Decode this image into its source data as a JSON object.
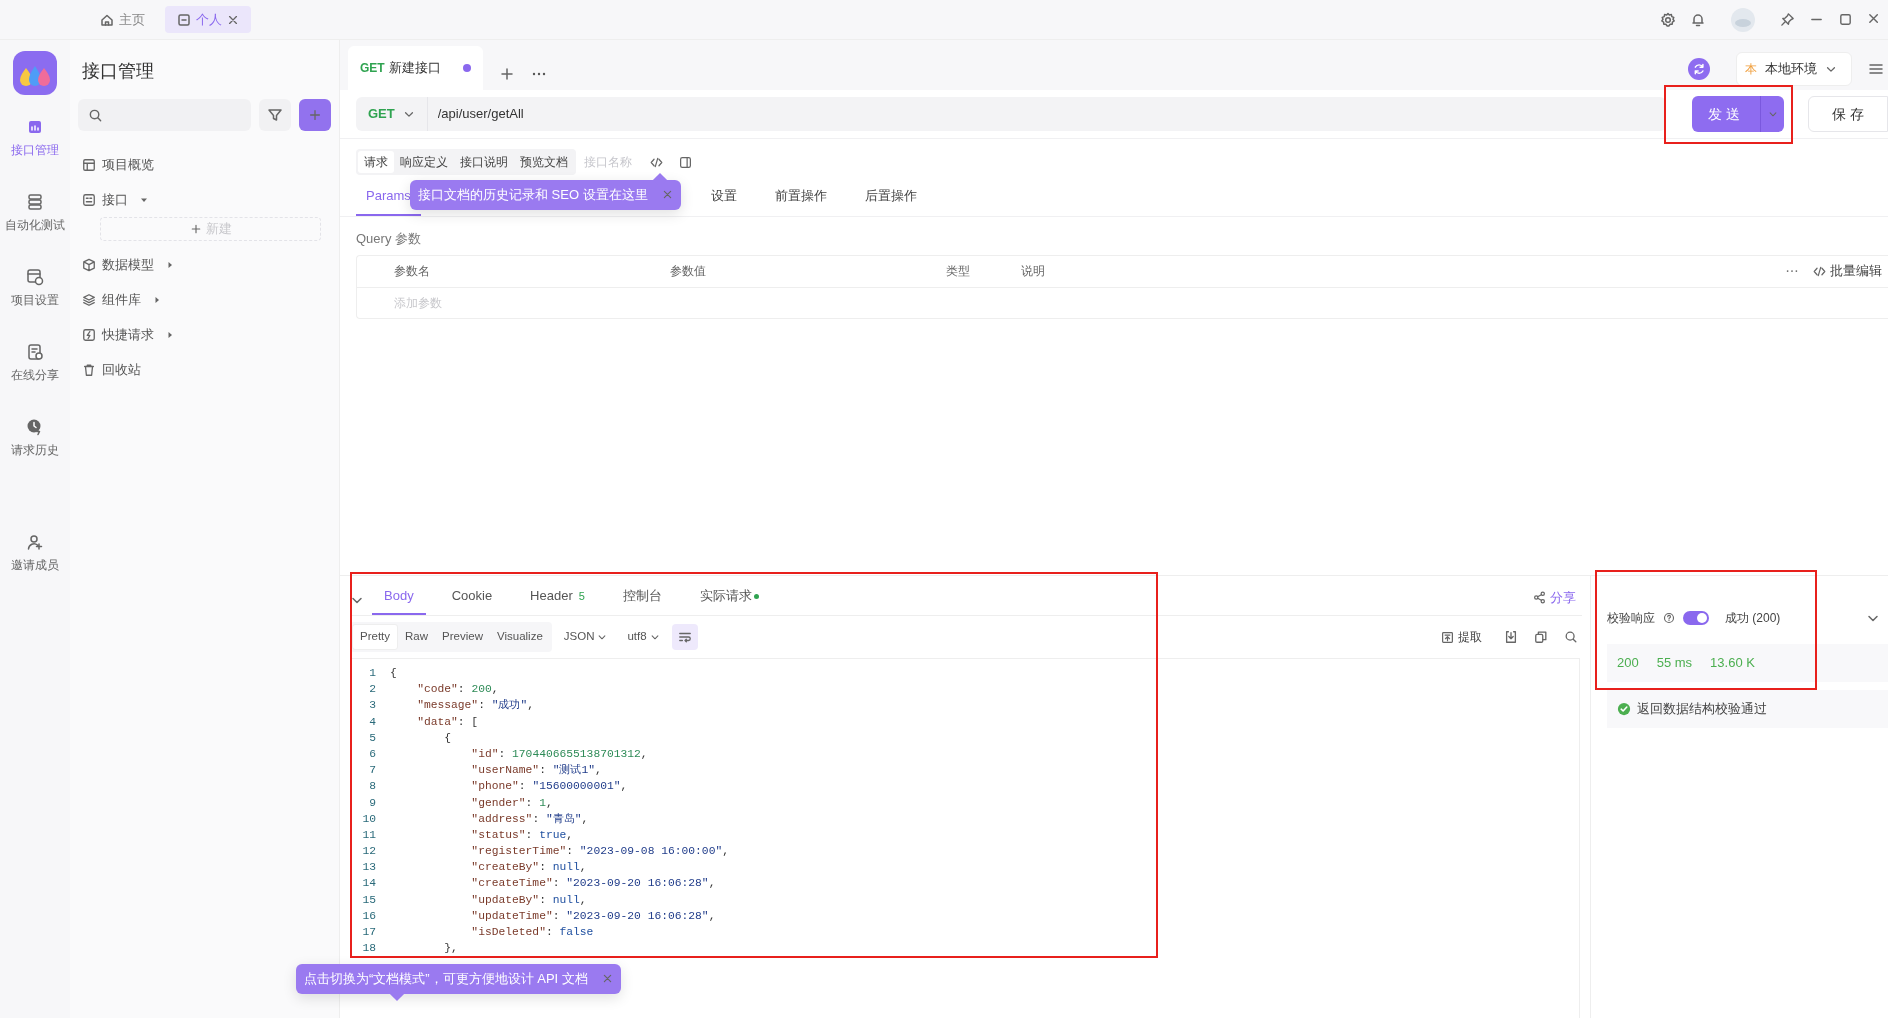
{
  "title_bar": {
    "tabs": [
      {
        "label": "主页",
        "selected": false,
        "closable": false
      },
      {
        "label": "个人",
        "selected": true,
        "closable": true
      }
    ]
  },
  "rail": {
    "items": [
      {
        "label": "接口管理",
        "selected": true
      },
      {
        "label": "自动化测试",
        "selected": false
      },
      {
        "label": "项目设置",
        "selected": false
      },
      {
        "label": "在线分享",
        "selected": false
      },
      {
        "label": "请求历史",
        "selected": false
      },
      {
        "label": "邀请成员",
        "selected": false
      }
    ]
  },
  "sidebar": {
    "title": "接口管理",
    "items": [
      {
        "label": "项目概览",
        "kind": "page"
      },
      {
        "label": "接口",
        "kind": "folder",
        "expanded": true,
        "new_label": "新建"
      },
      {
        "label": "数据模型",
        "kind": "folder",
        "expanded": false
      },
      {
        "label": "组件库",
        "kind": "folder",
        "expanded": false
      },
      {
        "label": "快捷请求",
        "kind": "folder",
        "expanded": false
      },
      {
        "label": "回收站",
        "kind": "page"
      }
    ]
  },
  "request_tabs": [
    {
      "method": "GET",
      "title": "新建接口",
      "modified": true,
      "selected": true
    }
  ],
  "environment": {
    "badge": "本",
    "name": "本地环境"
  },
  "url_bar": {
    "method": "GET",
    "url": "/api/user/getAll"
  },
  "send_button": {
    "label": "发送",
    "highlighted": true
  },
  "save_button": {
    "label": "保 存"
  },
  "doc_tabs": [
    {
      "label": "请求",
      "selected": true
    },
    {
      "label": "响应定义",
      "selected": false
    },
    {
      "label": "接口说明",
      "selected": false
    },
    {
      "label": "预览文档",
      "selected": false
    }
  ],
  "name_placeholder": "接口名称",
  "param_tabs": [
    {
      "label": "Params",
      "selected": true
    },
    {
      "label": "设置",
      "selected": false
    },
    {
      "label": "前置操作",
      "selected": false
    },
    {
      "label": "后置操作",
      "selected": false
    }
  ],
  "tooltips": [
    {
      "text": "接口文档的历史记录和 SEO 设置在这里"
    },
    {
      "text": "点击切换为“文档模式”，可更方便地设计 API 文档"
    }
  ],
  "query": {
    "label": "Query 参数",
    "columns": [
      "参数名",
      "参数值",
      "类型",
      "说明"
    ],
    "bulk_edit": "批量编辑",
    "add_placeholder": "添加参数"
  },
  "response": {
    "highlighted": true,
    "share": "分享",
    "extract": "提取",
    "type_select": "JSON",
    "encoding_select": "utf8",
    "wrap": true,
    "tabs": [
      {
        "label": "Body",
        "selected": true
      },
      {
        "label": "Cookie",
        "selected": false
      },
      {
        "label": "Header",
        "count": "5",
        "selected": false
      },
      {
        "label": "控制台",
        "selected": false
      },
      {
        "label": "实际请求",
        "dot": true,
        "selected": false
      }
    ],
    "formats": [
      {
        "label": "Pretty",
        "selected": true
      },
      {
        "label": "Raw",
        "selected": false
      },
      {
        "label": "Preview",
        "selected": false
      },
      {
        "label": "Visualize",
        "selected": false
      }
    ],
    "lines": [
      {
        "number": "1",
        "code": "{"
      },
      {
        "number": "2",
        "code": "    \"code\": 200,"
      },
      {
        "number": "3",
        "code": "    \"message\": \"成功\","
      },
      {
        "number": "4",
        "code": "    \"data\": ["
      },
      {
        "number": "5",
        "code": "        {"
      },
      {
        "number": "6",
        "code": "            \"id\": 1704406655138701312,"
      },
      {
        "number": "7",
        "code": "            \"userName\": \"测试1\","
      },
      {
        "number": "8",
        "code": "            \"phone\": \"15600000001\","
      },
      {
        "number": "9",
        "code": "            \"gender\": 1,"
      },
      {
        "number": "10",
        "code": "            \"address\": \"青岛\","
      },
      {
        "number": "11",
        "code": "            \"status\": true,"
      },
      {
        "number": "12",
        "code": "            \"registerTime\": \"2023-09-08 16:00:00\","
      },
      {
        "number": "13",
        "code": "            \"createBy\": null,"
      },
      {
        "number": "14",
        "code": "            \"createTime\": \"2023-09-20 16:06:28\","
      },
      {
        "number": "15",
        "code": "            \"updateBy\": null,"
      },
      {
        "number": "16",
        "code": "            \"updateTime\": \"2023-09-20 16:06:28\","
      },
      {
        "number": "17",
        "code": "            \"isDeleted\": false"
      },
      {
        "number": "18",
        "code": "        },"
      }
    ]
  },
  "validation": {
    "highlighted": true,
    "label": "校验响应",
    "enabled": true,
    "result": "成功 (200)",
    "status": "200",
    "time": "55 ms",
    "size": "13.60 K",
    "message": "返回数据结构校验通过"
  }
}
